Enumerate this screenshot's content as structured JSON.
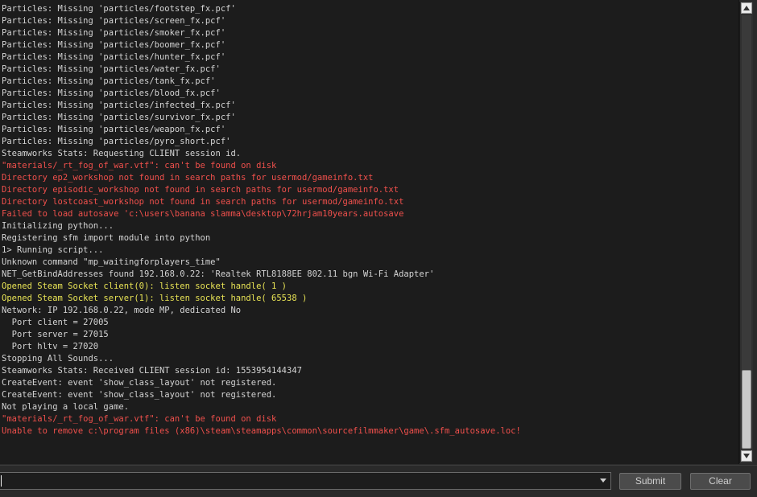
{
  "console": {
    "lines": [
      {
        "text": "Particles: Missing 'particles/footstep_fx.pcf'",
        "level": "normal"
      },
      {
        "text": "Particles: Missing 'particles/screen_fx.pcf'",
        "level": "normal"
      },
      {
        "text": "Particles: Missing 'particles/smoker_fx.pcf'",
        "level": "normal"
      },
      {
        "text": "Particles: Missing 'particles/boomer_fx.pcf'",
        "level": "normal"
      },
      {
        "text": "Particles: Missing 'particles/hunter_fx.pcf'",
        "level": "normal"
      },
      {
        "text": "Particles: Missing 'particles/water_fx.pcf'",
        "level": "normal"
      },
      {
        "text": "Particles: Missing 'particles/tank_fx.pcf'",
        "level": "normal"
      },
      {
        "text": "Particles: Missing 'particles/blood_fx.pcf'",
        "level": "normal"
      },
      {
        "text": "Particles: Missing 'particles/infected_fx.pcf'",
        "level": "normal"
      },
      {
        "text": "Particles: Missing 'particles/survivor_fx.pcf'",
        "level": "normal"
      },
      {
        "text": "Particles: Missing 'particles/weapon_fx.pcf'",
        "level": "normal"
      },
      {
        "text": "Particles: Missing 'particles/pyro_short.pcf'",
        "level": "normal"
      },
      {
        "text": "Steamworks Stats: Requesting CLIENT session id.",
        "level": "normal"
      },
      {
        "text": "\"materials/_rt_fog_of_war.vtf\": can't be found on disk",
        "level": "error"
      },
      {
        "text": "Directory ep2_workshop not found in search paths for usermod/gameinfo.txt",
        "level": "error"
      },
      {
        "text": "Directory episodic_workshop not found in search paths for usermod/gameinfo.txt",
        "level": "error"
      },
      {
        "text": "Directory lostcoast_workshop not found in search paths for usermod/gameinfo.txt",
        "level": "error"
      },
      {
        "text": "Failed to load autosave 'c:\\users\\banana slamma\\desktop\\72hrjam10years.autosave",
        "level": "error"
      },
      {
        "text": "Initializing python...",
        "level": "normal"
      },
      {
        "text": "Registering sfm import module into python",
        "level": "normal"
      },
      {
        "text": "1> Running script...",
        "level": "normal"
      },
      {
        "text": "Unknown command \"mp_waitingforplayers_time\"",
        "level": "normal"
      },
      {
        "text": "NET_GetBindAddresses found 192.168.0.22: 'Realtek RTL8188EE 802.11 bgn Wi-Fi Adapter'",
        "level": "normal"
      },
      {
        "text": "Opened Steam Socket client(0): listen socket handle( 1 )",
        "level": "warn"
      },
      {
        "text": "Opened Steam Socket server(1): listen socket handle( 65538 )",
        "level": "warn"
      },
      {
        "text": "Network: IP 192.168.0.22, mode MP, dedicated No",
        "level": "normal"
      },
      {
        "text": "  Port client = 27005",
        "level": "normal"
      },
      {
        "text": "  Port server = 27015",
        "level": "normal"
      },
      {
        "text": "  Port hltv = 27020",
        "level": "normal"
      },
      {
        "text": "Stopping All Sounds...",
        "level": "normal"
      },
      {
        "text": "Steamworks Stats: Received CLIENT session id: 1553954144347",
        "level": "normal"
      },
      {
        "text": "CreateEvent: event 'show_class_layout' not registered.",
        "level": "normal"
      },
      {
        "text": "CreateEvent: event 'show_class_layout' not registered.",
        "level": "normal"
      },
      {
        "text": "Not playing a local game.",
        "level": "normal"
      },
      {
        "text": "\"materials/_rt_fog_of_war.vtf\": can't be found on disk",
        "level": "error"
      },
      {
        "text": "Unable to remove c:\\program files (x86)\\steam\\steamapps\\common\\sourcefilmmaker\\game\\.sfm_autosave.loc!",
        "level": "error"
      }
    ],
    "scroll_position": 0.92
  },
  "colors": {
    "normal": "#d4d4d4",
    "error": "#f0504c",
    "warn": "#e9e455"
  },
  "command_bar": {
    "input_value": "",
    "submit_label": "Submit",
    "clear_label": "Clear"
  },
  "icons": {
    "scroll_up": "triangle-up-icon",
    "scroll_down": "triangle-down-icon",
    "dropdown": "triangle-down-icon"
  }
}
